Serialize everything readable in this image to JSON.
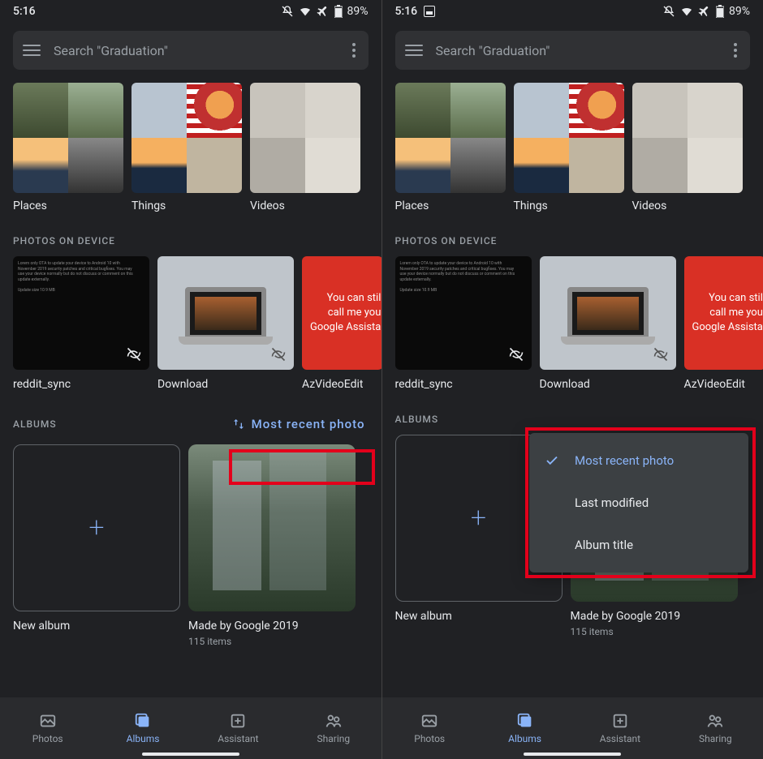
{
  "status": {
    "time": "5:16",
    "battery": "89%"
  },
  "search": {
    "placeholder": "Search \"Graduation\""
  },
  "categories": [
    {
      "label": "Places"
    },
    {
      "label": "Things"
    },
    {
      "label": "Videos"
    }
  ],
  "sections": {
    "device_header": "PHOTOS ON DEVICE",
    "albums_header": "ALBUMS"
  },
  "device_folders": [
    {
      "label": "reddit_sync"
    },
    {
      "label": "Download"
    },
    {
      "label": "AzVideoEdit",
      "teaser": "You can stil\ncall me you\nGoogle Assista"
    }
  ],
  "sort": {
    "chip_label": "Most recent photo",
    "options": [
      {
        "label": "Most recent photo",
        "selected": true
      },
      {
        "label": "Last modified",
        "selected": false
      },
      {
        "label": "Album title",
        "selected": false
      }
    ]
  },
  "albums": [
    {
      "label": "New album"
    },
    {
      "label": "Made by Google 2019",
      "sub": "115 items"
    }
  ],
  "nav": [
    {
      "label": "Photos"
    },
    {
      "label": "Albums"
    },
    {
      "label": "Assistant"
    },
    {
      "label": "Sharing"
    }
  ]
}
